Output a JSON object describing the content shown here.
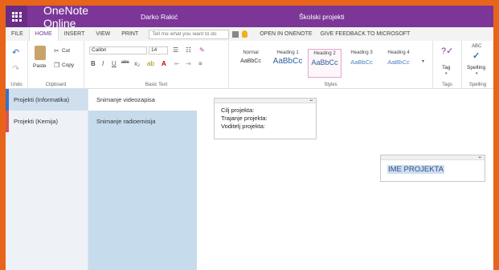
{
  "titlebar": {
    "app_name": "OneNote Online",
    "user_name": "Darko Rakić",
    "notebook_title": "Školski projekti"
  },
  "tabs": {
    "file": "FILE",
    "home": "HOME",
    "insert": "INSERT",
    "view": "VIEW",
    "print": "PRINT",
    "tellme_placeholder": "Tell me what you want to do",
    "open_in_onenote": "OPEN IN ONENOTE",
    "feedback": "GIVE FEEDBACK TO MICROSOFT"
  },
  "ribbon": {
    "undo": {
      "label": "Undo"
    },
    "clipboard": {
      "label": "Clipboard",
      "paste": "Paste",
      "cut": "Cut",
      "copy": "Copy"
    },
    "basic_text": {
      "label": "Basic Text",
      "font": "Calibri",
      "size": "14"
    },
    "styles": {
      "label": "Styles",
      "items": [
        {
          "name": "Normal",
          "sample": "AaBbCc"
        },
        {
          "name": "Heading 1",
          "sample": "AaBbCc"
        },
        {
          "name": "Heading 2",
          "sample": "AaBbCc"
        },
        {
          "name": "Heading 3",
          "sample": "AaBbCc"
        },
        {
          "name": "Heading 4",
          "sample": "AaBbCc"
        }
      ]
    },
    "tags": {
      "label": "Tags",
      "tag": "Tag"
    },
    "spelling": {
      "label": "Spelling",
      "button": "Spelling",
      "abc": "ABC"
    }
  },
  "sections": [
    {
      "label": "Projekti (Informatika)",
      "color": "#3a6fc4"
    },
    {
      "label": "Projekti (Kemija)",
      "color": "#d9534f"
    }
  ],
  "pages": [
    {
      "label": "Snimanje videozapisa"
    },
    {
      "label": "Snimanje radioemisija"
    }
  ],
  "note1": {
    "lines": [
      "Cilj projekta:",
      "Trajanje projekta:",
      "Voditelj projekta:"
    ]
  },
  "note2": {
    "title": "IME PROJEKTA"
  },
  "colors": {
    "brand": "#7b3697",
    "frame": "#e8641a"
  }
}
